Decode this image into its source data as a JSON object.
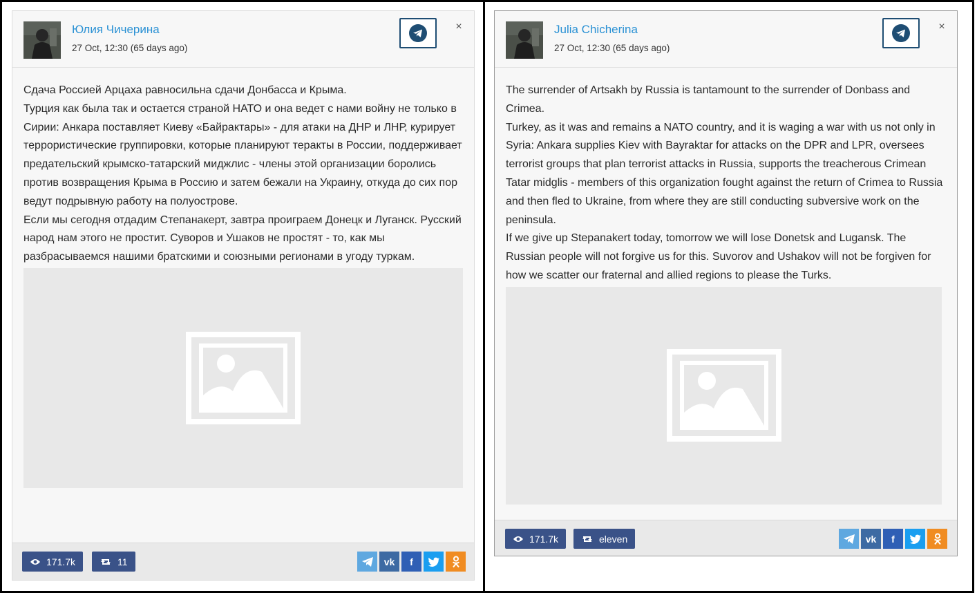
{
  "left": {
    "author": "Юлия Чичерина",
    "date": "27 Oct, 12:30 (65 days ago)",
    "paragraphs": [
      "Сдача Россией Арцаха равносильна сдачи Донбасса и Крыма.",
      "Турция как была так и остается страной НАТО и она ведет с нами войну не только в Сирии: Анкара поставляет Киеву «Байрактары» - для атаки на ДНР и ЛНР, курирует террористические группировки, которые планируют теракты в России, поддерживает предательский крымско-татарский миджлис - члены этой организации боролись против возвращения Крыма в Россию и затем бежали на Украину, откуда до сих пор ведут подрывную работу на полуострове.",
      "Если мы сегодня отдадим Степанакерт, завтра проиграем Донецк и Луганск. Русский народ нам этого не простит. Суворов и Ушаков не простят - то, как мы разбрасываемся нашими братскими и союзными регионами в угоду туркам."
    ],
    "views": "171.7k",
    "reposts": "11"
  },
  "right": {
    "author": "Julia Chicherina",
    "date": "27 Oct, 12:30 (65 days ago)",
    "paragraphs": [
      "The surrender of Artsakh by Russia is tantamount to the surrender of Donbass and Crimea.",
      "Turkey, as it was and remains a NATO country, and it is waging a war with us not only in Syria: Ankara supplies Kiev with Bayraktar for attacks on the DPR and LPR, oversees terrorist groups that plan terrorist attacks in Russia, supports the treacherous Crimean Tatar midglis - members of this organization fought against the return of Crimea to Russia and then fled to Ukraine, from where they are still conducting subversive work on the peninsula.",
      "If we give up Stepanakert today, tomorrow we will lose Donetsk and Lugansk. The Russian people will not forgive us for this. Suvorov and Ushakov will not be forgiven for how we scatter our fraternal and allied regions to please the Turks."
    ],
    "views": "171.7k",
    "reposts": "eleven"
  },
  "icons": {
    "telegram": "telegram-icon",
    "close": "close-icon",
    "eye": "eye-icon",
    "repost": "repost-icon",
    "vk": "vk-icon",
    "facebook": "facebook-icon",
    "twitter": "twitter-icon",
    "odnoklassniki": "odnoklassniki-icon"
  },
  "colors": {
    "link": "#2a91d4",
    "stat_bg": "#3a5288",
    "telegram_border": "#1e4d73"
  }
}
